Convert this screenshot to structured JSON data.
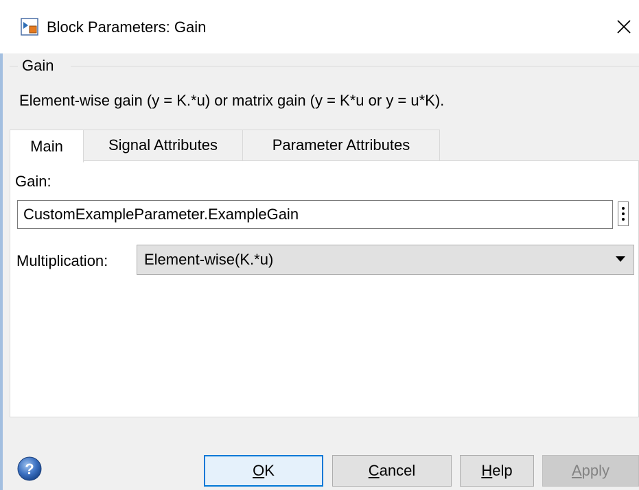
{
  "window": {
    "title": "Block Parameters: Gain",
    "icon": "simulink-block-icon",
    "close": "close-icon"
  },
  "group": {
    "title": "Gain",
    "description": "Element-wise gain (y = K.*u) or matrix gain (y = K*u or y = u*K)."
  },
  "tabs": [
    {
      "label": "Main",
      "active": true
    },
    {
      "label": "Signal Attributes",
      "active": false
    },
    {
      "label": "Parameter Attributes",
      "active": false
    }
  ],
  "main": {
    "gain_label": "Gain:",
    "gain_value": "CustomExampleParameter.ExampleGain",
    "multiplication_label": "Multiplication:",
    "multiplication_value": "Element-wise(K.*u)"
  },
  "buttons": {
    "ok": {
      "first": "O",
      "rest": "K"
    },
    "cancel": {
      "first": "C",
      "rest": "ancel"
    },
    "help": {
      "first": "H",
      "rest": "elp"
    },
    "apply": {
      "first": "A",
      "rest": "pply"
    }
  },
  "colors": {
    "accent": "#0078d7",
    "panel": "#f0f0f0",
    "disabled_text": "#838383"
  }
}
